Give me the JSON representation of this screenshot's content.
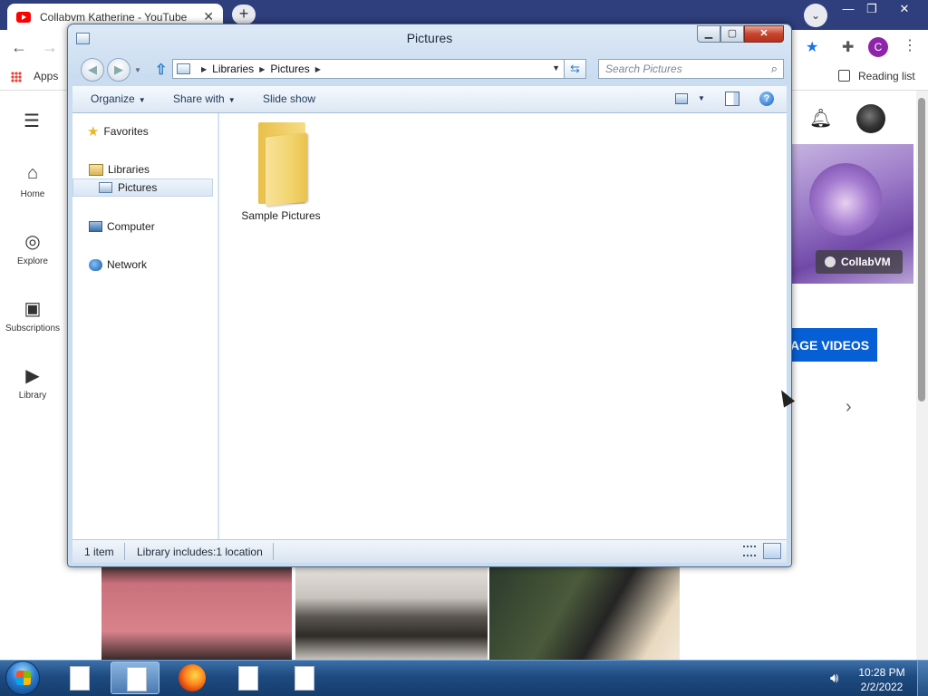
{
  "browser": {
    "tab_title": "Collabvm Katherine - YouTube",
    "tab_close": "✕",
    "new_tab": "+",
    "apps_label": "Apps",
    "reading_list": "Reading list",
    "profile_letter": "C",
    "accent_color": "#1a73e8"
  },
  "youtube": {
    "nav": [
      {
        "label": "Home",
        "icon": "home-icon",
        "glyph": "⌂"
      },
      {
        "label": "Explore",
        "icon": "compass-icon",
        "glyph": "◎"
      },
      {
        "label": "Subscriptions",
        "icon": "subscriptions-icon",
        "glyph": "▣"
      },
      {
        "label": "Library",
        "icon": "library-icon",
        "glyph": "▶"
      }
    ],
    "badge_label": "CollabVM",
    "blue_button": "AGE VIDEOS",
    "chevron": "›",
    "brand_color": "#065fd4"
  },
  "explorer": {
    "title": "Pictures",
    "address": {
      "crumbs": [
        "Libraries",
        "Pictures"
      ]
    },
    "search_placeholder": "Search Pictures",
    "commands": {
      "organize": "Organize",
      "share_with": "Share with",
      "slide_show": "Slide show"
    },
    "nav_pane": {
      "favorites": "Favorites",
      "libraries": "Libraries",
      "pictures": "Pictures",
      "computer": "Computer",
      "network": "Network"
    },
    "items": [
      {
        "label": "Sample Pictures",
        "icon": "folder-icon"
      }
    ],
    "status": {
      "count": "1 item",
      "library": "Library includes:1 location"
    },
    "help": "?"
  },
  "taskbar": {
    "time": "10:28 PM",
    "date": "2/2/2022"
  }
}
